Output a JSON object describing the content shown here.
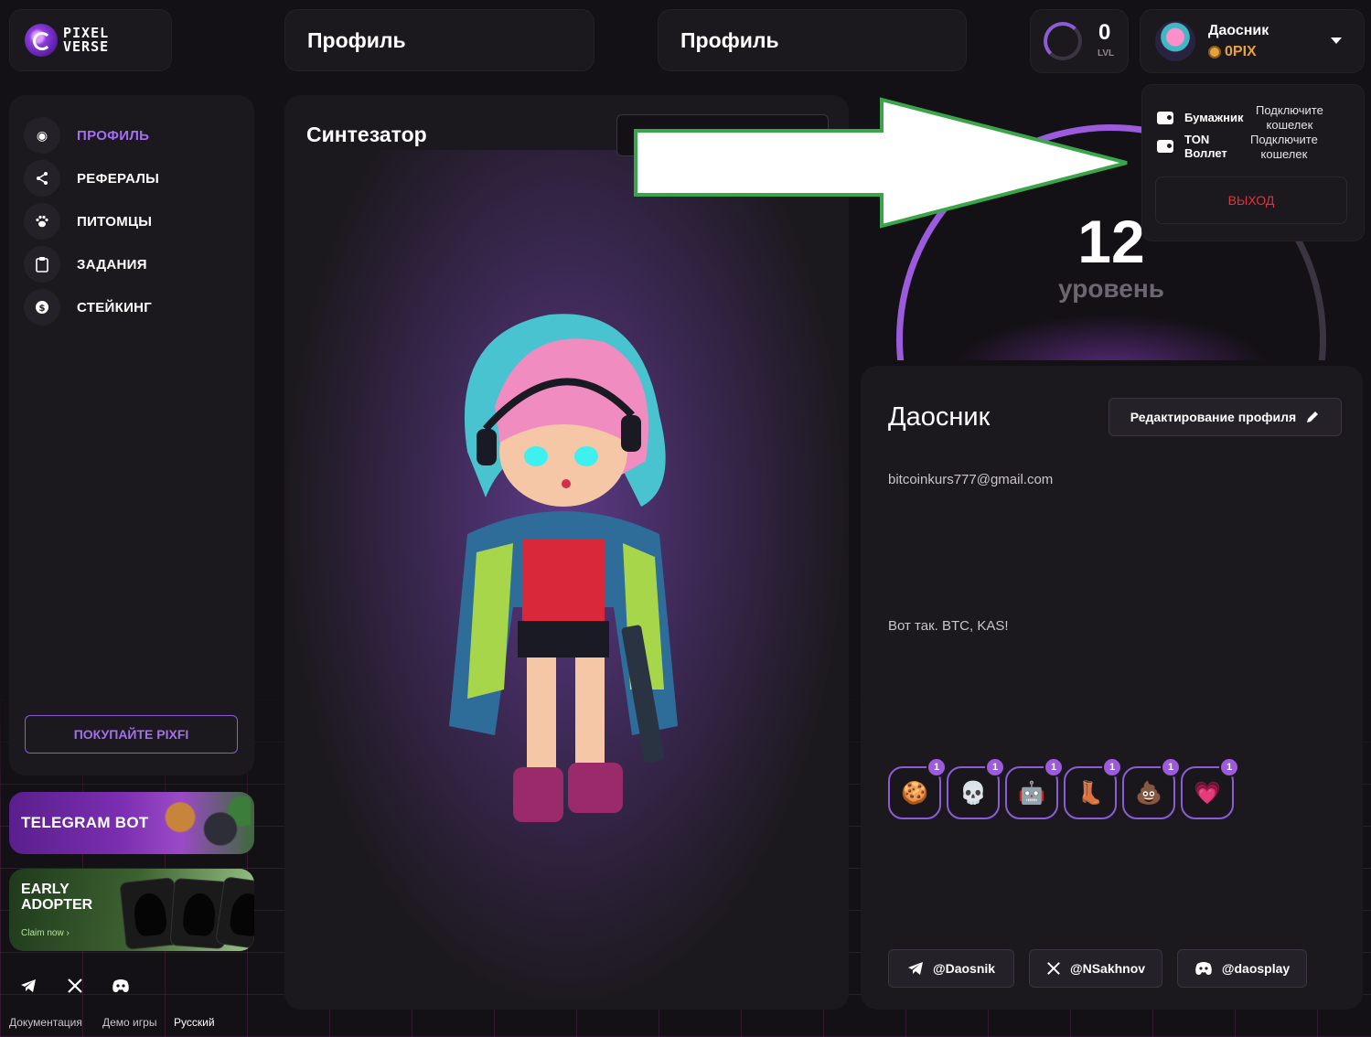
{
  "header": {
    "logo_text_1": "PIXEL",
    "logo_text_2": "VERSE",
    "title_left": "Профиль",
    "title_right": "Профиль",
    "level_value": "0",
    "level_label": "LVL",
    "user_name": "Даосник",
    "user_balance": "0PIX"
  },
  "sidebar": {
    "items": [
      {
        "label": "ПРОФИЛЬ",
        "icon": "user-circle-icon"
      },
      {
        "label": "РЕФЕРАЛЫ",
        "icon": "share-icon"
      },
      {
        "label": "ПИТОМЦЫ",
        "icon": "paw-icon"
      },
      {
        "label": "ЗАДАНИЯ",
        "icon": "clipboard-icon"
      },
      {
        "label": "СТЕЙКИНГ",
        "icon": "dollar-coin-icon"
      }
    ],
    "buy_label": "ПОКУПАЙТЕ PIXFI"
  },
  "promos": {
    "telegram": "TELEGRAM BOT",
    "early_line1": "EARLY",
    "early_line2": "ADOPTER",
    "early_cta": "Claim now  ›"
  },
  "footer": {
    "docs": "Документация",
    "demo": "Демо игры",
    "lang": "Русский"
  },
  "synth": {
    "title": "Синтезатор"
  },
  "level": {
    "value": "12",
    "word": "уровень"
  },
  "profile": {
    "name": "Даосник",
    "edit_label": "Редактирование профиля",
    "email": "bitcoinkurs777@gmail.com",
    "bio": "Вот так. BTC, KAS!",
    "badges": [
      {
        "icon": "cookie-icon",
        "glyph": "🍪",
        "count": "1"
      },
      {
        "icon": "skull-icon",
        "glyph": "💀",
        "count": "1"
      },
      {
        "icon": "robot-icon",
        "glyph": "🤖",
        "count": "1"
      },
      {
        "icon": "boot-icon",
        "glyph": "👢",
        "count": "1"
      },
      {
        "icon": "poop-icon",
        "glyph": "💩",
        "count": "1"
      },
      {
        "icon": "rainbow-heart-icon",
        "glyph": "💗",
        "count": "1"
      }
    ],
    "socials": {
      "telegram": "@Daosnik",
      "x": "@NSakhnov",
      "discord": "@daosplay"
    }
  },
  "dropdown": {
    "wallet1_name": "Бумажник",
    "wallet1_action_1": "Подключите",
    "wallet1_action_2": "кошелек",
    "wallet2_name_1": "TON",
    "wallet2_name_2": "Воллет",
    "wallet2_action_1": "Подключите",
    "wallet2_action_2": "кошелек",
    "logout": "ВЫХОД"
  },
  "colors": {
    "accent": "#9b5bdc",
    "danger": "#e0343c",
    "coin": "#e6a23c",
    "annotation_arrow": "#3aa64a"
  }
}
